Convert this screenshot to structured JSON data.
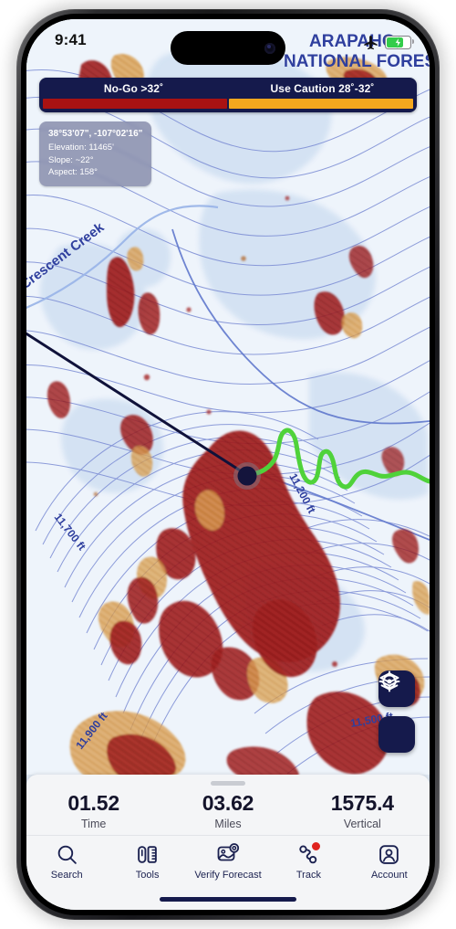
{
  "status_bar": {
    "time": "9:41",
    "airplane_icon": "airplane-mode-icon",
    "battery_icon": "battery-charging-icon",
    "battery_charging": true
  },
  "map": {
    "area_label_line1": "ARAPAHO",
    "area_label_line2": "NATIONAL FOREST",
    "stream_label": "Crescent Creek",
    "contour_labels": [
      "11,200 ft",
      "11,700 ft",
      "11,900 ft",
      "11,500 ft"
    ],
    "colors": {
      "no_go": "#a81f1f",
      "caution": "#f0a81e",
      "contour": "#6b7fd0",
      "track": "#4fd23a",
      "measure_line": "#10123a",
      "waypoint": "#14143c",
      "base": "#eef4fb",
      "water_shade": "#cfe0f2"
    }
  },
  "legend": {
    "no_go_label": "No-Go >32˚",
    "caution_label": "Use Caution 28˚-32˚",
    "no_go_color": "#a81212",
    "caution_color": "#f5a81e",
    "background": "#151a4c"
  },
  "info_panel": {
    "coordinates": "38°53'07\", -107°02'16\"",
    "elevation": "Elevation: 11465'",
    "slope": "Slope: ~22°",
    "aspect": "Aspect: 158°"
  },
  "map_controls": [
    {
      "name": "layers-button",
      "icon": "layers-icon"
    },
    {
      "name": "locate-button",
      "icon": "locate-crosshair-icon"
    }
  ],
  "sheet": {
    "stats": [
      {
        "value": "01.52",
        "label": "Time"
      },
      {
        "value": "03.62",
        "label": "Miles"
      },
      {
        "value": "1575.4",
        "label": "Vertical"
      }
    ]
  },
  "tabs": [
    {
      "label": "Search",
      "icon": "search-icon",
      "badge": false
    },
    {
      "label": "Tools",
      "icon": "tools-icon",
      "badge": false
    },
    {
      "label": "Verify Forecast",
      "icon": "verify-forecast-icon",
      "badge": false
    },
    {
      "label": "Track",
      "icon": "track-route-icon",
      "badge": true
    },
    {
      "label": "Account",
      "icon": "account-person-icon",
      "badge": false
    }
  ]
}
